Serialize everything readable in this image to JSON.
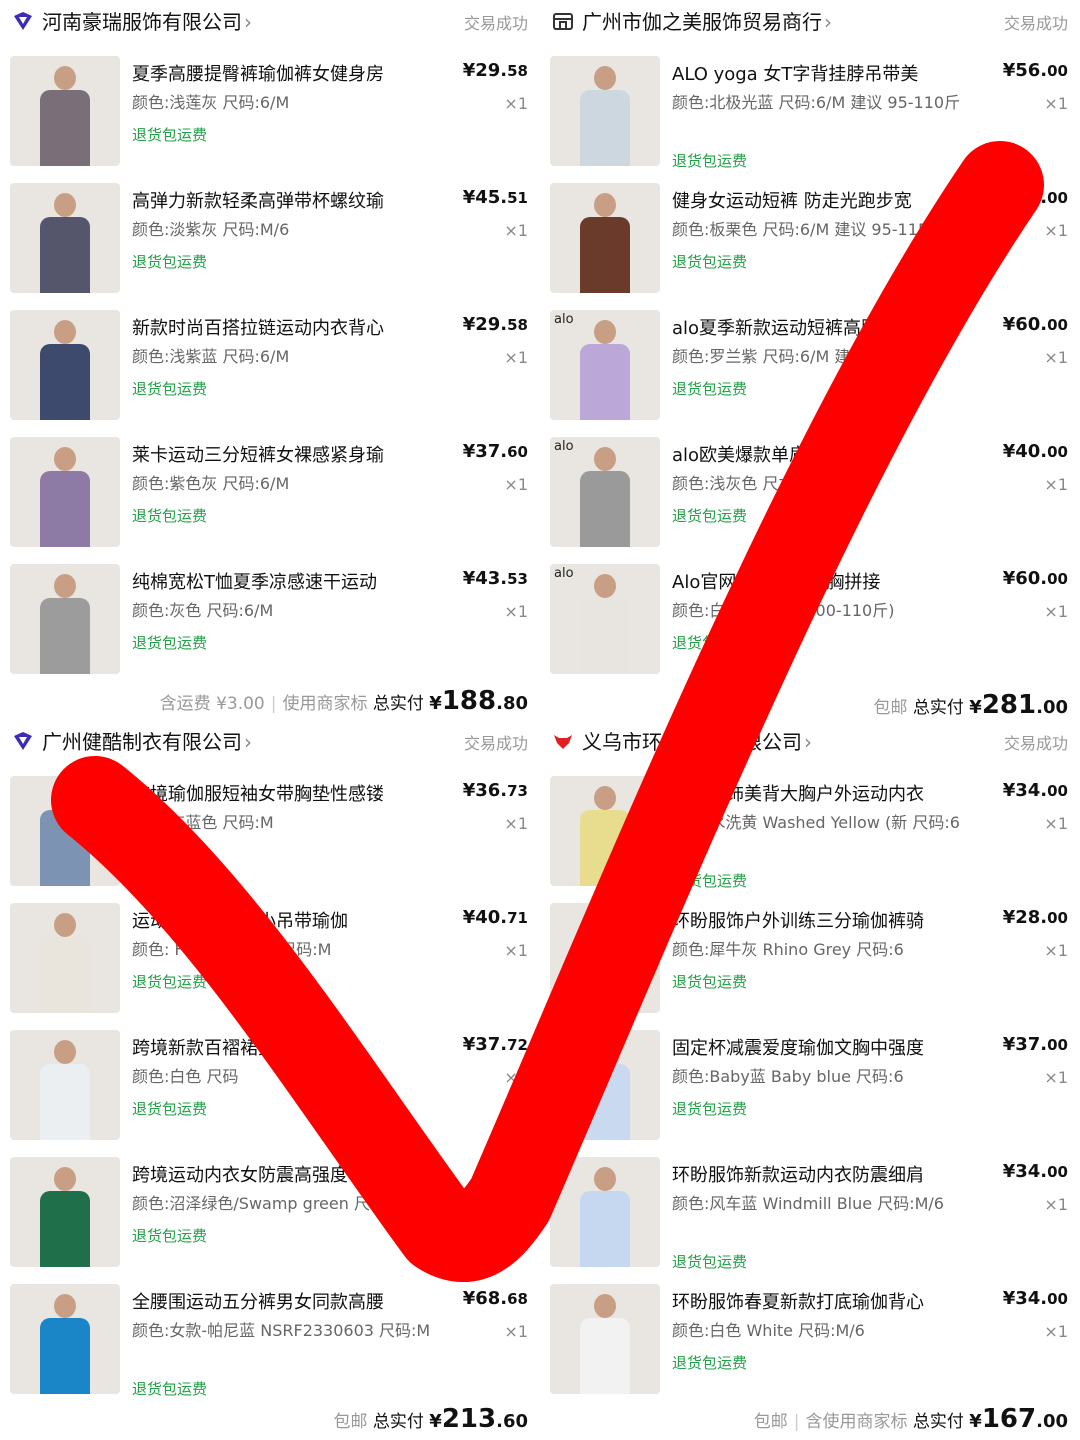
{
  "shops": [
    {
      "name": "河南豪瑞服饰有限公司",
      "status": "交易成功",
      "items": [
        {
          "title": "夏季高腰提臀裤瑜伽裤女健身房",
          "spec": "颜色:浅莲灰 尺码:6/M",
          "price_main": "¥29.",
          "price_cents": "58",
          "qty": "×1",
          "tag": "退货包运费"
        },
        {
          "title": "高弹力新款轻柔高弹带杯螺纹瑜",
          "spec": "颜色:淡紫灰 尺码:M/6",
          "price_main": "¥45.",
          "price_cents": "51",
          "qty": "×1",
          "tag": "退货包运费"
        },
        {
          "title": "新款时尚百搭拉链运动内衣背心",
          "spec": "颜色:浅紫蓝 尺码:6/M",
          "price_main": "¥29.",
          "price_cents": "58",
          "qty": "×1",
          "tag": "退货包运费"
        },
        {
          "title": "莱卡运动三分短裤女裸感紧身瑜",
          "spec": "颜色:紫色灰 尺码:6/M",
          "price_main": "¥37.",
          "price_cents": "60",
          "qty": "×1",
          "tag": "退货包运费"
        },
        {
          "title": "纯棉宽松T恤夏季凉感速干运动",
          "spec": "颜色:灰色 尺码:6/M",
          "price_main": "¥43.",
          "price_cents": "53",
          "qty": "×1",
          "tag": "退货包运费"
        }
      ],
      "summary": {
        "shipping": "含运费 ¥3.00",
        "extra": "使用商家标",
        "label": "总实付",
        "yen": "¥",
        "big": "188",
        "cents": ".80"
      }
    },
    {
      "name": "广州市伽之美服饰贸易商行",
      "status": "交易成功",
      "items": [
        {
          "title": "ALO yoga 女T字背挂脖吊带美",
          "spec": "颜色:北极光蓝 尺码:6/M 建议 95-110斤",
          "price_main": "¥56.",
          "price_cents": "00",
          "qty": "×1",
          "tag": "退货包运费"
        },
        {
          "title": "健身女运动短裤 防走光跑步宽",
          "spec": "颜色:板栗色 尺码:6/M 建议 95-115斤",
          "price_main": "¥65.",
          "price_cents": "00",
          "qty": "×1",
          "tag": "退货包运费"
        },
        {
          "title": "alo夏季新款运动短裤高腰",
          "spec": "颜色:罗兰紫 尺码:6/M 建议 95-115斤",
          "price_main": "¥60.",
          "price_cents": "00",
          "qty": "×1",
          "tag": "退货包运费"
        },
        {
          "title": "alo欧美爆款单肩包时尚潮",
          "spec": "颜色:浅灰色 尺寸",
          "price_main": "¥40.",
          "price_cents": "00",
          "qty": "×1",
          "tag": "退货包运费"
        },
        {
          "title": "Alo官网同款瑜伽文胸拼接",
          "spec": "颜色:白蛋 尺码:6 (100-110斤)",
          "price_main": "¥60.",
          "price_cents": "00",
          "qty": "×1",
          "tag": "退货包运费"
        }
      ],
      "summary": {
        "shipping": "",
        "extra": "包邮",
        "label": "总实付",
        "yen": "¥",
        "big": "281",
        "cents": ".00"
      }
    },
    {
      "name": "广州健酷制衣有限公司",
      "status": "交易成功",
      "items": [
        {
          "title": "跨境瑜伽服短袖女带胸垫性感镂",
          "spec": "颜色:灰蓝色 尺码:M",
          "price_main": "¥36.",
          "price_cents": "73",
          "qty": "×1",
          "tag": "退货包运费"
        },
        {
          "title": "运动女亲肤裸感小吊带瑜伽",
          "spec": "颜色: FBF2216201 尺码:M",
          "price_main": "¥40.",
          "price_cents": "71",
          "qty": "×1",
          "tag": "退货包运费"
        },
        {
          "title": "跨境新款百褶裙女假俩防走",
          "spec": "颜色:白色 尺码",
          "price_main": "¥37.",
          "price_cents": "72",
          "qty": "×1",
          "tag": "退货包运费"
        },
        {
          "title": "跨境运动内衣女防震高强度",
          "spec": "颜色:沼泽绿色/Swamp green 尺码:M",
          "price_main": "",
          "price_cents": "",
          "qty": "",
          "tag": "退货包运费"
        },
        {
          "title": "全腰围运动五分裤男女同款高腰",
          "spec": "颜色:女款-帕尼蓝 NSRF2330603 尺码:M",
          "price_main": "¥68.",
          "price_cents": "68",
          "qty": "×1",
          "tag": "退货包运费"
        }
      ],
      "summary": {
        "shipping": "",
        "extra": "包邮",
        "label": "总实付",
        "yen": "¥",
        "big": "213",
        "cents": ".60"
      }
    },
    {
      "name": "义乌市环盼服饰有限公司",
      "status": "交易成功",
      "items": [
        {
          "title": "环盼服饰美背大胸户外运动内衣",
          "spec": "颜色:水洗黄 Washed Yellow (新 尺码:6",
          "price_main": "¥34.",
          "price_cents": "00",
          "qty": "×1",
          "tag": "退货包运费"
        },
        {
          "title": "环盼服饰户外训练三分瑜伽裤骑",
          "spec": "颜色:犀牛灰 Rhino Grey 尺码:6",
          "price_main": "¥28.",
          "price_cents": "00",
          "qty": "×1",
          "tag": "退货包运费"
        },
        {
          "title": "固定杯减震爱度瑜伽文胸中强度",
          "spec": "颜色:Baby蓝 Baby blue 尺码:6",
          "price_main": "¥37.",
          "price_cents": "00",
          "qty": "×1",
          "tag": "退货包运费"
        },
        {
          "title": "环盼服饰新款运动内衣防震细肩",
          "spec": "颜色:风车蓝 Windmill Blue 尺码:M/6",
          "price_main": "¥34.",
          "price_cents": "00",
          "qty": "×1",
          "tag": "退货包运费"
        },
        {
          "title": "环盼服饰春夏新款打底瑜伽背心",
          "spec": "颜色:白色 White 尺码:M/6",
          "price_main": "¥34.",
          "price_cents": "00",
          "qty": "×1",
          "tag": "退货包运费"
        }
      ],
      "summary": {
        "shipping": "包邮",
        "extra": "含使用商家标",
        "label": "总实付",
        "yen": "¥",
        "big": "167",
        "cents": ".00"
      }
    }
  ],
  "thumb_brands": [
    "",
    "",
    "",
    "",
    "",
    "",
    "",
    "alo",
    "alo",
    "alo",
    "",
    "",
    "",
    "",
    "",
    "",
    "",
    "",
    "",
    ""
  ],
  "colors": {
    "accent_green": "#23a047",
    "check_red": "#ff0000",
    "shop_logo_purple": "#3a2bb8",
    "shop_logo_red": "#e02020"
  },
  "icons": [
    "shop-diamond-icon",
    "store-icon",
    "shop-diamond-icon",
    "bull-logo-icon",
    "chevron-right-icon"
  ]
}
